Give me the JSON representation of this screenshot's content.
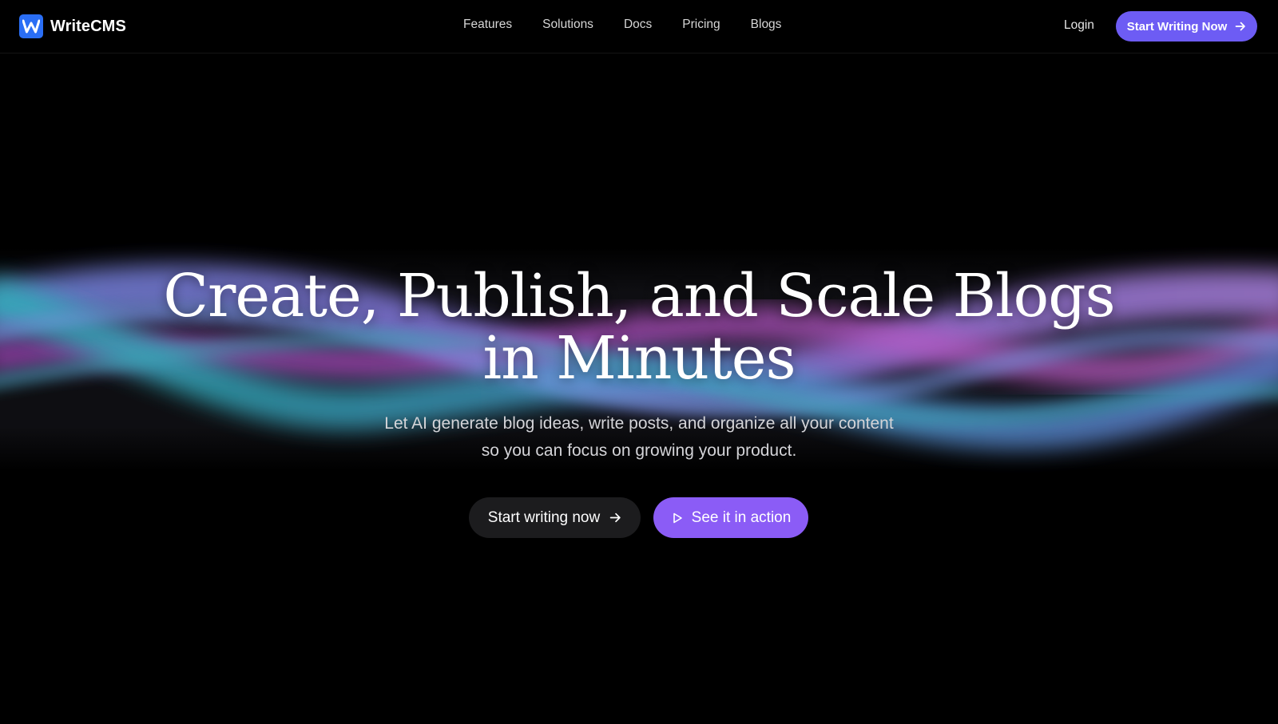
{
  "brand": {
    "logo_letter": "W",
    "name": "WriteCMS",
    "logo_color": "#2a6ef5"
  },
  "nav": {
    "links": [
      "Features",
      "Solutions",
      "Docs",
      "Pricing",
      "Blogs"
    ],
    "login": "Login",
    "cta": "Start Writing Now",
    "cta_icon": "arrow-right-icon"
  },
  "hero": {
    "title_line1": "Create, Publish, and Scale Blogs",
    "title_line2": "in Minutes",
    "subtitle_line1": "Let AI generate blog ideas, write posts, and organize all your content",
    "subtitle_line2": "so you can focus on growing your product.",
    "primary_button": "Start writing now",
    "primary_icon": "arrow-right-icon",
    "secondary_button": "See it in action",
    "secondary_icon": "play-icon"
  },
  "colors": {
    "background": "#000000",
    "nav_cta": "#6d5cf4",
    "secondary_button": "#8b5cf6",
    "primary_button": "#1c1c1e",
    "wave_cyan": "#2fc3c9",
    "wave_violet": "#8a7cf0",
    "wave_pink": "#c45ad8"
  }
}
